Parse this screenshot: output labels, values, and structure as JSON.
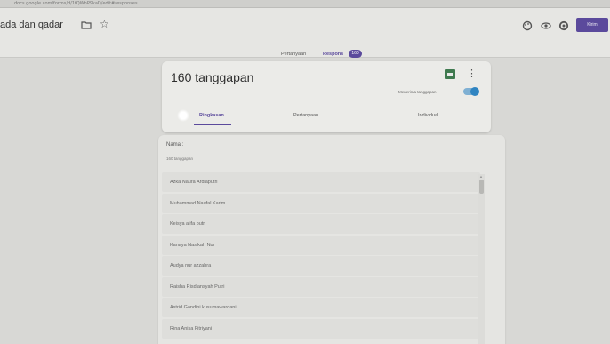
{
  "browser": {
    "url": "docs.google.com/forms/d/1fQWhP9kaD/edit#responses"
  },
  "header": {
    "doc_title": "ada dan qadar",
    "icons": [
      "folder-icon",
      "star-icon",
      "palette-icon",
      "eye-icon",
      "settings-icon"
    ],
    "send_label": "Kirim",
    "tabs": [
      {
        "label": "Pertanyaan"
      },
      {
        "label": "Respons"
      }
    ],
    "response_badge": "160",
    "accent_color": "#5b4a9c"
  },
  "summary": {
    "count_label": "160 tanggapan",
    "accept_label": "Menerima tanggapan",
    "accepting": true,
    "subtabs": [
      {
        "label": "Ringkasan"
      },
      {
        "label": "Pertanyaan"
      },
      {
        "label": "Individual"
      }
    ]
  },
  "names_card": {
    "field_label": "Nama :",
    "field_sub": "160 tanggapan",
    "items": [
      "Azka Naura Ardiaputri",
      "Muhammad Naufal Karim",
      "Keisya alifa putri",
      "Kanaya Nasikah Nur",
      "Audya nur azzahra",
      "Raisha Risdiansyah Putri",
      "Astrid Gandini kusumawardani",
      "Rina Anisa Fitriyani"
    ]
  }
}
